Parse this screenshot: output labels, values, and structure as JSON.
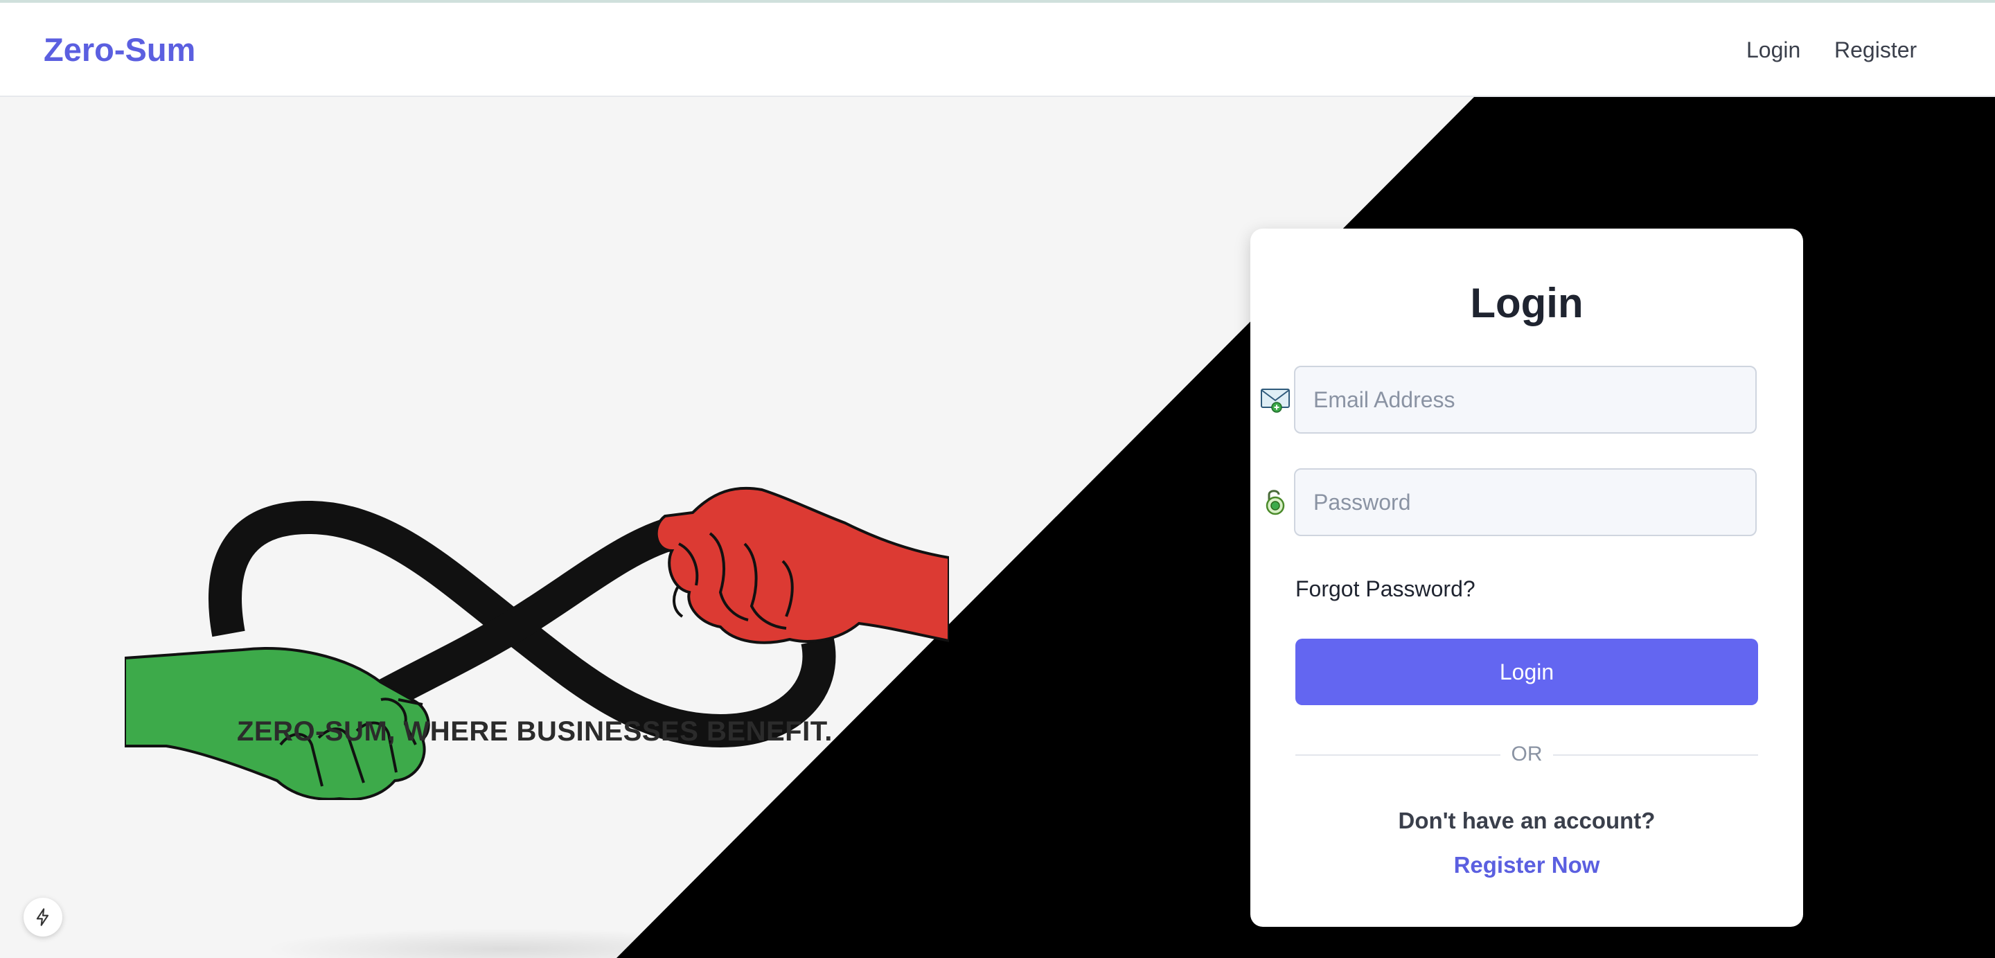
{
  "navbar": {
    "brand": "Zero-Sum",
    "links": {
      "login": "Login",
      "register": "Register"
    }
  },
  "hero": {
    "tagline": "ZERO-SUM, WHERE BUSINESSES BENEFIT."
  },
  "login_form": {
    "title": "Login",
    "email_placeholder": "Email Address",
    "email_value": "",
    "password_placeholder": "Password",
    "password_value": "",
    "forgot_password": "Forgot Password?",
    "submit_label": "Login",
    "divider_text": "OR",
    "no_account_text": "Don't have an account?",
    "register_link": "Register Now"
  },
  "icons": {
    "email": "envelope-icon",
    "password": "padlock-icon",
    "dev_tools": "lightning-bolt-icon"
  },
  "colors": {
    "brand": "#5b5fe0",
    "button": "#6366f1",
    "hero_light": "#f5f5f5",
    "hero_dark": "#000000",
    "left_hand": "#3daa4a",
    "right_hand": "#dc3a33"
  }
}
